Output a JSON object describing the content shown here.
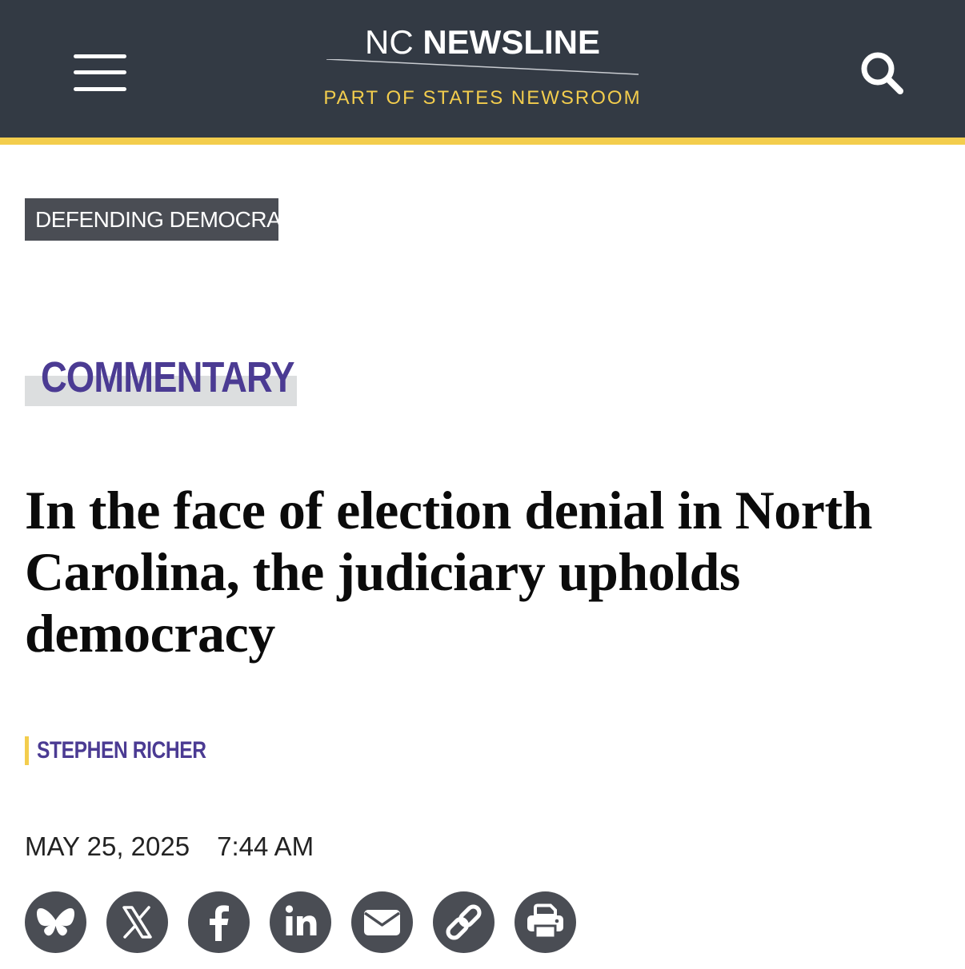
{
  "colors": {
    "header_bg": "#333a44",
    "accent_yellow": "#f3cd4d",
    "accent_purple": "#4b3b93",
    "tag_bg": "#4a4d54",
    "share_bg": "#4a4d54"
  },
  "header": {
    "menu_icon": "hamburger-menu-icon",
    "logo": {
      "prefix": "NC",
      "name": "NEWSLINE",
      "tagline": "PART OF STATES NEWSROOM"
    },
    "search_icon": "search-icon"
  },
  "article": {
    "category": "DEFENDING DEMOCRACY",
    "section": "COMMENTARY",
    "headline": "In the face of election denial in North Carolina, the judiciary upholds democracy",
    "author": "STEPHEN RICHER",
    "date": "MAY 25, 2025",
    "time": "7:44 AM"
  },
  "share": [
    {
      "icon": "bluesky-icon"
    },
    {
      "icon": "x-twitter-icon"
    },
    {
      "icon": "facebook-icon"
    },
    {
      "icon": "linkedin-icon"
    },
    {
      "icon": "email-icon"
    },
    {
      "icon": "link-icon"
    },
    {
      "icon": "print-icon"
    }
  ]
}
